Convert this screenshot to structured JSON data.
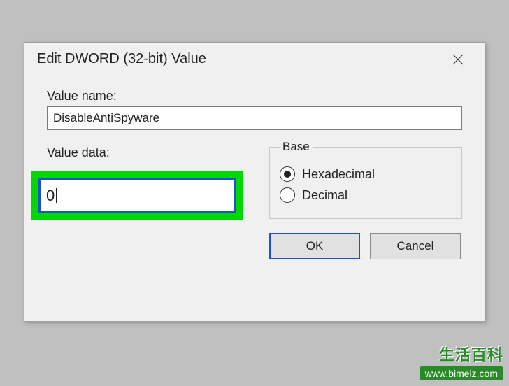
{
  "dialog": {
    "title": "Edit DWORD (32-bit) Value"
  },
  "valueName": {
    "label": "Value name:",
    "value": "DisableAntiSpyware"
  },
  "valueData": {
    "label": "Value data:",
    "value": "0"
  },
  "base": {
    "legend": "Base",
    "hexadecimal": "Hexadecimal",
    "decimal": "Decimal",
    "selected": "hexadecimal"
  },
  "buttons": {
    "ok": "OK",
    "cancel": "Cancel"
  },
  "watermark": {
    "line1": "生活百科",
    "line2": "www.bimeiz.com"
  }
}
